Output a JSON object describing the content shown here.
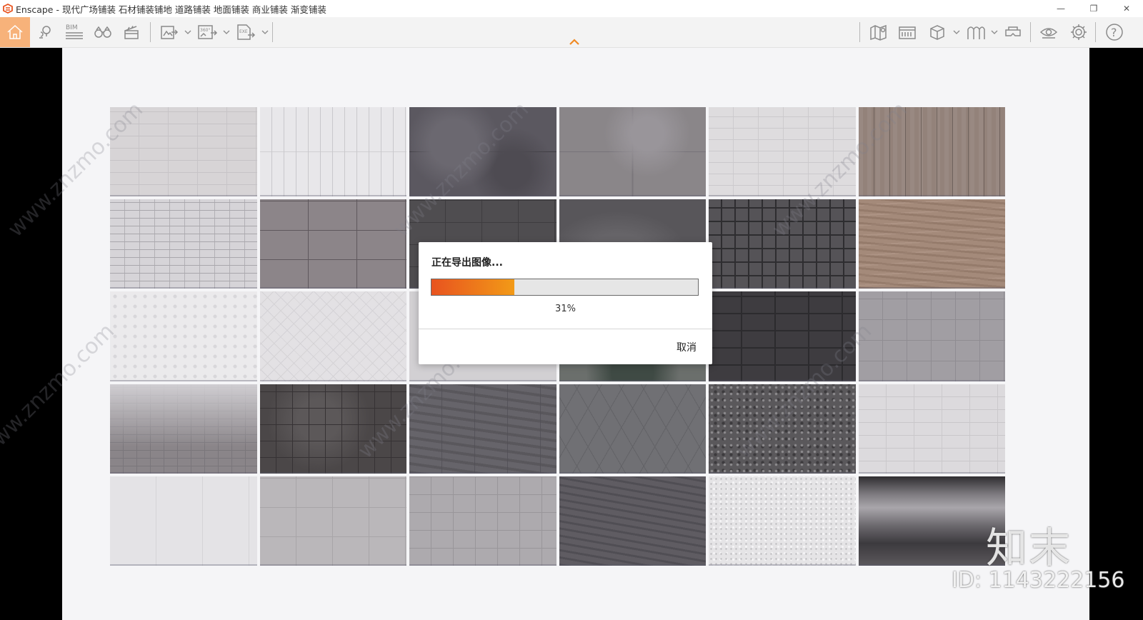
{
  "window": {
    "title": "Enscape - 现代广场铺装 石材铺装铺地 道路铺装 地面铺装 商业铺装 渐变铺装",
    "minimize_icon": "—",
    "restore_icon": "❐",
    "close_icon": "✕"
  },
  "toolbar": {
    "bim_label": "BIM",
    "panorama_label": "360°",
    "exe_label": "EXE",
    "help_label": "?"
  },
  "dialog": {
    "title": "正在导出图像...",
    "progress_percent": 31,
    "progress_text": "31%",
    "cancel_label": "取消"
  },
  "watermark": {
    "site": "www.znzmo.com",
    "brand_mark": "知末",
    "id_label": "ID: 1143222156"
  },
  "material_tiles": [
    "t-lightbrick",
    "t-whiteplank",
    "t-darkstone",
    "t-greystone",
    "t-lightbrick2",
    "t-woodplank",
    "t-mixbrick",
    "t-bigtile",
    "t-darkgrid",
    "t-darkmarble",
    "t-darksmallgrid",
    "t-wood",
    "t-whitedots",
    "t-whiteherring",
    "t-palestone",
    "t-greenmarble",
    "t-darkslate",
    "t-greytile",
    "t-gradient-tiles",
    "t-darkmarbletile",
    "t-woodgrey",
    "t-greyherring",
    "t-gravel",
    "t-lightbrick3",
    "t-whitemarble",
    "t-lightgreytile",
    "t-greyplank",
    "t-darkwoodgrey",
    "t-terrazzo",
    "t-metal"
  ],
  "colors": {
    "accent": "#f08a24",
    "progress_start": "#e8531f",
    "progress_end": "#f29a17",
    "home_active": "#f7b27a"
  }
}
